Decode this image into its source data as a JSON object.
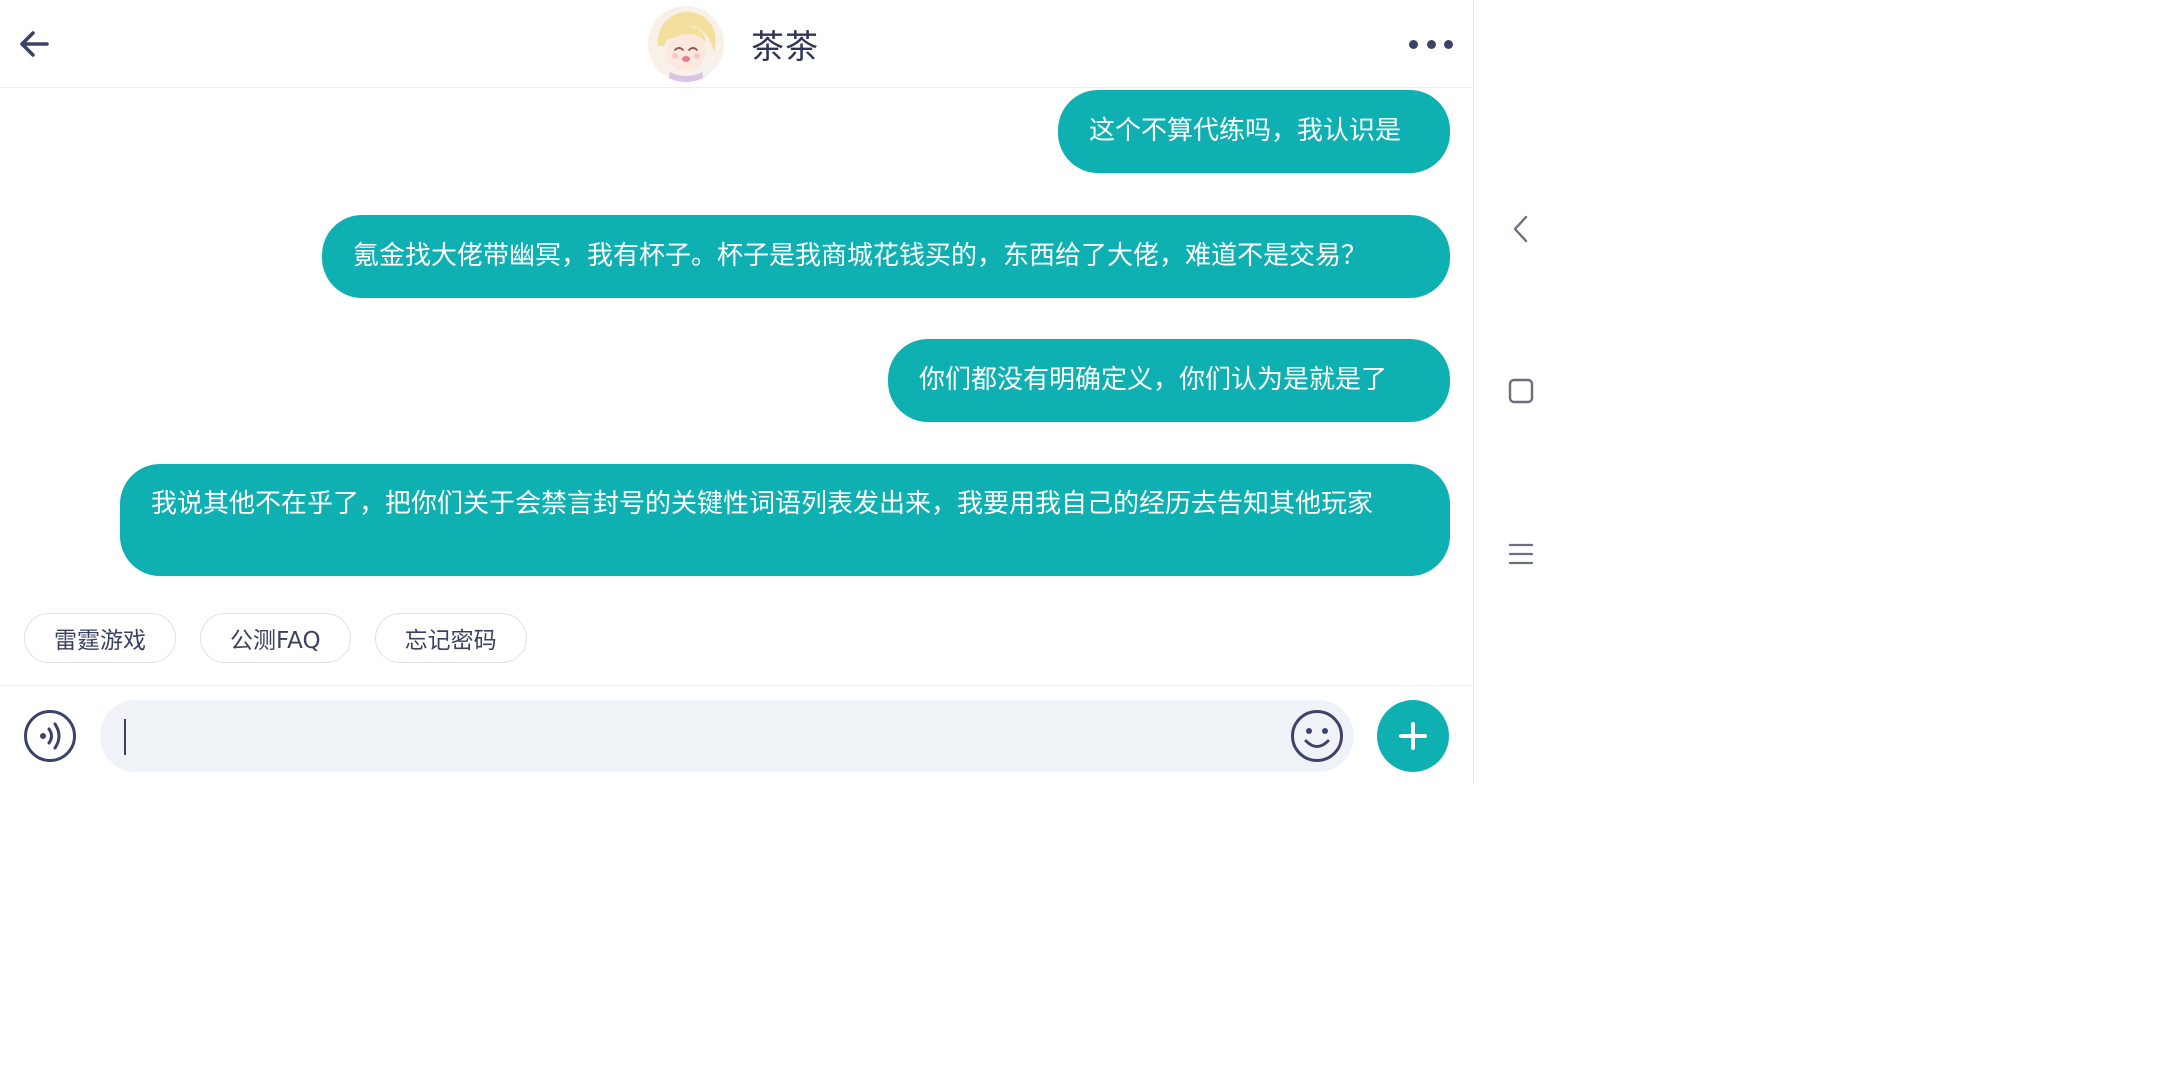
{
  "header": {
    "title": "茶茶"
  },
  "messages": [
    {
      "text": "这个不算代练吗，我认识是",
      "from": "me"
    },
    {
      "text": "氪金找大佬带幽冥，我有杯子。杯子是我商城花钱买的，东西给了大佬，难道不是交易？",
      "from": "me"
    },
    {
      "text": "你们都没有明确定义，你们认为是就是了",
      "from": "me"
    },
    {
      "text": "我说其他不在乎了，把你们关于会禁言封号的关键性词语列表发出来，我要用我自己的经历去告知其他玩家",
      "from": "me"
    }
  ],
  "quick_replies": [
    "雷霆游戏",
    "公测FAQ",
    "忘记密码"
  ],
  "input": {
    "value": "",
    "placeholder": ""
  },
  "colors": {
    "bubble": "#0fb0b1",
    "accent": "#0fb0b1",
    "icon": "#3c4368"
  },
  "icons": {
    "back": "arrow-left-icon",
    "more": "more-dots-icon",
    "voice": "voice-icon",
    "emoji": "emoji-icon",
    "plus": "plus-icon",
    "sys_back": "chevron-left-icon",
    "sys_home": "square-icon",
    "sys_menu": "menu-lines-icon"
  }
}
